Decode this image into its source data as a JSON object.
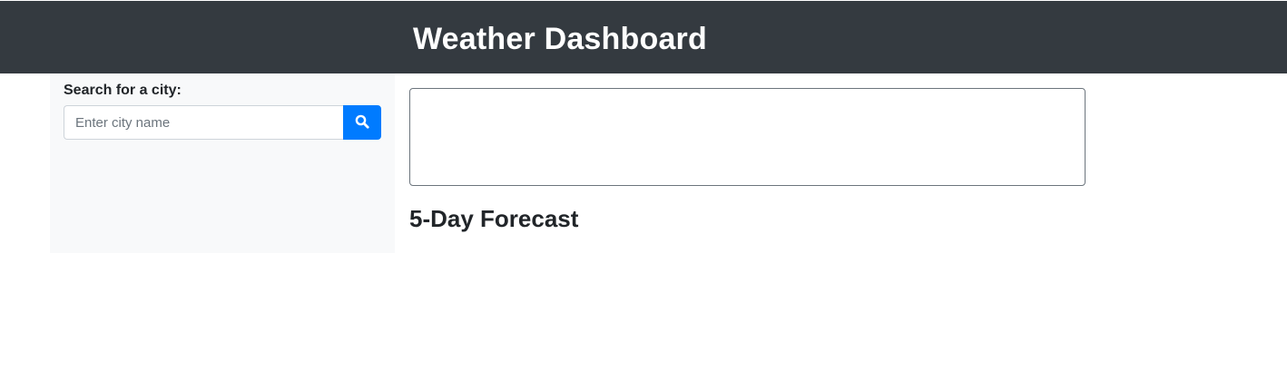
{
  "header": {
    "title": "Weather Dashboard"
  },
  "sidebar": {
    "search_label": "Search for a city:",
    "search_placeholder": "Enter city name",
    "search_value": "",
    "search_button_icon": "search-icon"
  },
  "main": {
    "forecast_heading": "5-Day Forecast"
  },
  "colors": {
    "header_bg": "#343a40",
    "sidebar_bg": "#f8f9fa",
    "accent": "#007bff",
    "card_border": "#6c757d"
  }
}
